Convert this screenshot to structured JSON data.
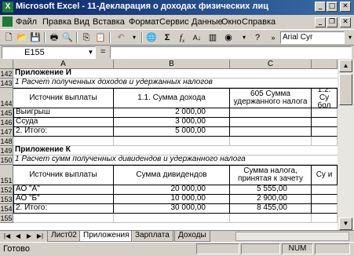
{
  "window": {
    "title": "Microsoft Excel - 11-Декларация о доходах физических лиц",
    "app_icon": "excel-icon",
    "controls": [
      "minimize-icon",
      "maximize-icon",
      "close-icon"
    ]
  },
  "menu": {
    "items": [
      "Файл",
      "Правка",
      "Вид",
      "Вставка",
      "Формат",
      "Сервис",
      "Данные",
      "Окно",
      "Справка"
    ],
    "doc_controls": [
      "_",
      "❐",
      "✕"
    ]
  },
  "toolbar": {
    "icons": [
      "new-file-icon",
      "open-icon",
      "save-icon",
      "print-icon",
      "preview-icon",
      "copy-icon",
      "undo-icon",
      "sum-icon",
      "function-icon",
      "sort-asc-icon",
      "chart-icon",
      "zoom-icon",
      "help-icon"
    ],
    "font_name": "Arial Cyr"
  },
  "formula_bar": {
    "cell_ref": "E155",
    "equals": "=",
    "value": ""
  },
  "columns": [
    "A",
    "B",
    "C"
  ],
  "rows": [
    {
      "n": "142",
      "a": "Приложение И",
      "style": "bold"
    },
    {
      "n": "143",
      "a": "1  Расчет полученных доходов и удержанных налогов",
      "style": "ital"
    },
    {
      "n": "144",
      "a": "Источник выплаты",
      "b": "1.1. Сумма дохода",
      "c": "605 Сумма удержанного налога",
      "d": "1.2. Су бол",
      "style": "header"
    },
    {
      "n": "145",
      "a": "Выигрыш",
      "b": "2 000,00"
    },
    {
      "n": "146",
      "a": "Ссуда",
      "b": "3 000,00"
    },
    {
      "n": "147",
      "a": "2. Итого:",
      "b": "5 000,00"
    },
    {
      "n": "148",
      "a": ""
    },
    {
      "n": "149",
      "a": "Приложение К",
      "style": "bold"
    },
    {
      "n": "150",
      "a": "1  Расчет сумм полученных дивидендов и удержанного налога",
      "style": "ital"
    },
    {
      "n": "151",
      "a": "Источник выплаты",
      "b": "Сумма дивидендов",
      "c": "Сумма налога, принятая к зачету",
      "d": "Су и",
      "style": "header"
    },
    {
      "n": "152",
      "a": "АО \"А\"",
      "b": "20 000,00",
      "c": "5 555,00"
    },
    {
      "n": "153",
      "a": "АО \"Б\"",
      "b": "10 000,00",
      "c": "2 900,00"
    },
    {
      "n": "154",
      "a": "2. Итого:",
      "b": "30 000,00",
      "c": "8 455,00"
    },
    {
      "n": "155",
      "a": ""
    }
  ],
  "sheet_tabs": {
    "tabs": [
      "Лист02",
      "Приложения",
      "Зарплата",
      "Доходы"
    ],
    "active": "Приложения"
  },
  "status": {
    "text": "Готово",
    "num": "NUM"
  }
}
